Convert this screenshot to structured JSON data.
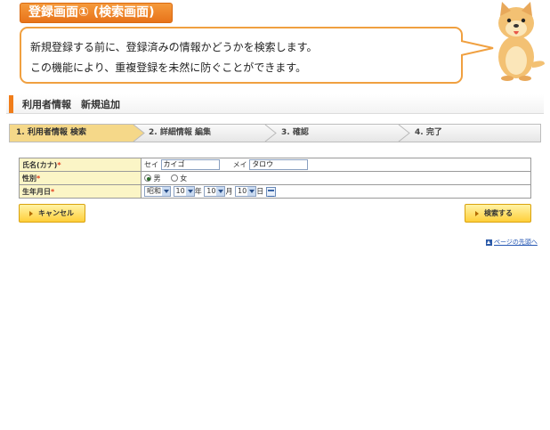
{
  "header": {
    "title": "登録画面① (検索画面)",
    "lines": [
      "新規登録する前に、登録済みの情報かどうかを検索します。",
      "この機能により、重複登録を未然に防ぐことができます。"
    ]
  },
  "page": {
    "heading": "利用者情報　新規追加"
  },
  "steps": [
    {
      "label": "1. 利用者情報 検索",
      "active": true
    },
    {
      "label": "2. 詳細情報 編集",
      "active": false
    },
    {
      "label": "3. 確認",
      "active": false
    },
    {
      "label": "4. 完了",
      "active": false
    }
  ],
  "form": {
    "required_mark": "*",
    "name": {
      "label": "氏名(カナ)",
      "sei_label": "セイ",
      "sei_value": "カイゴ",
      "mei_label": "メイ",
      "mei_value": "タロウ"
    },
    "gender": {
      "label": "性別",
      "options": [
        "男",
        "女"
      ],
      "selected": "男"
    },
    "birth": {
      "label": "生年月日",
      "era": "昭和",
      "year": "10",
      "year_unit": "年",
      "month": "10",
      "month_unit": "月",
      "day": "10",
      "day_unit": "日"
    }
  },
  "buttons": {
    "cancel": "キャンセル",
    "search": "検索する"
  },
  "pagetop": "ページの先頭へ",
  "colors": {
    "accent_orange": "#f07d1a",
    "step_active": "#f5d889",
    "label_bg": "#fbf5c6",
    "required": "#e23c1c",
    "link": "#2456b3"
  },
  "icons": {
    "mascot": "dog-mascot-icon",
    "calendar": "calendar-icon",
    "pagetop": "arrow-up-icon"
  }
}
